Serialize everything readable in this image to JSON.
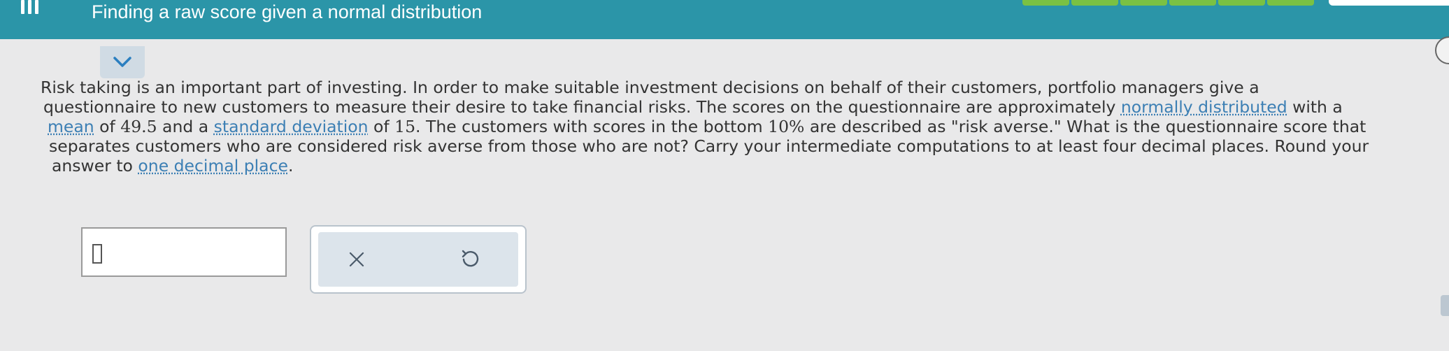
{
  "header": {
    "title": "Finding a raw score given a normal distribution",
    "progress_complete_segments": 6,
    "colors": {
      "bar": "#2b95a8",
      "progress": "#7ac143"
    }
  },
  "problem": {
    "l1": "Risk taking is an important part of investing. In order to make suitable investment decisions on behalf of their customers, portfolio managers give a",
    "l2": "questionnaire to new customers to measure their desire to take financial risks. The scores on the questionnaire are approximately ",
    "l2_link": "normally distributed",
    "l2_end": " with a",
    "l3_link_mean": "mean",
    "l3_a": " of ",
    "mean_value": "49.5",
    "l3_b": " and a ",
    "l3_link_sd": "standard deviation",
    "l3_c": " of ",
    "sd_value": "15",
    "l3_d": ". The customers with scores in the bottom ",
    "percent": "10%",
    "l3_e": " are described as \"risk averse.\" What is the questionnaire score that",
    "l4": "separates customers who are considered risk averse from those who are not? Carry your intermediate computations to at least four decimal places. Round your",
    "l5_a": "answer to ",
    "l5_link": "one decimal place",
    "l5_end": "."
  },
  "answer": {
    "value": ""
  },
  "actions": {
    "clear_icon": "x-icon",
    "undo_icon": "undo-icon"
  }
}
